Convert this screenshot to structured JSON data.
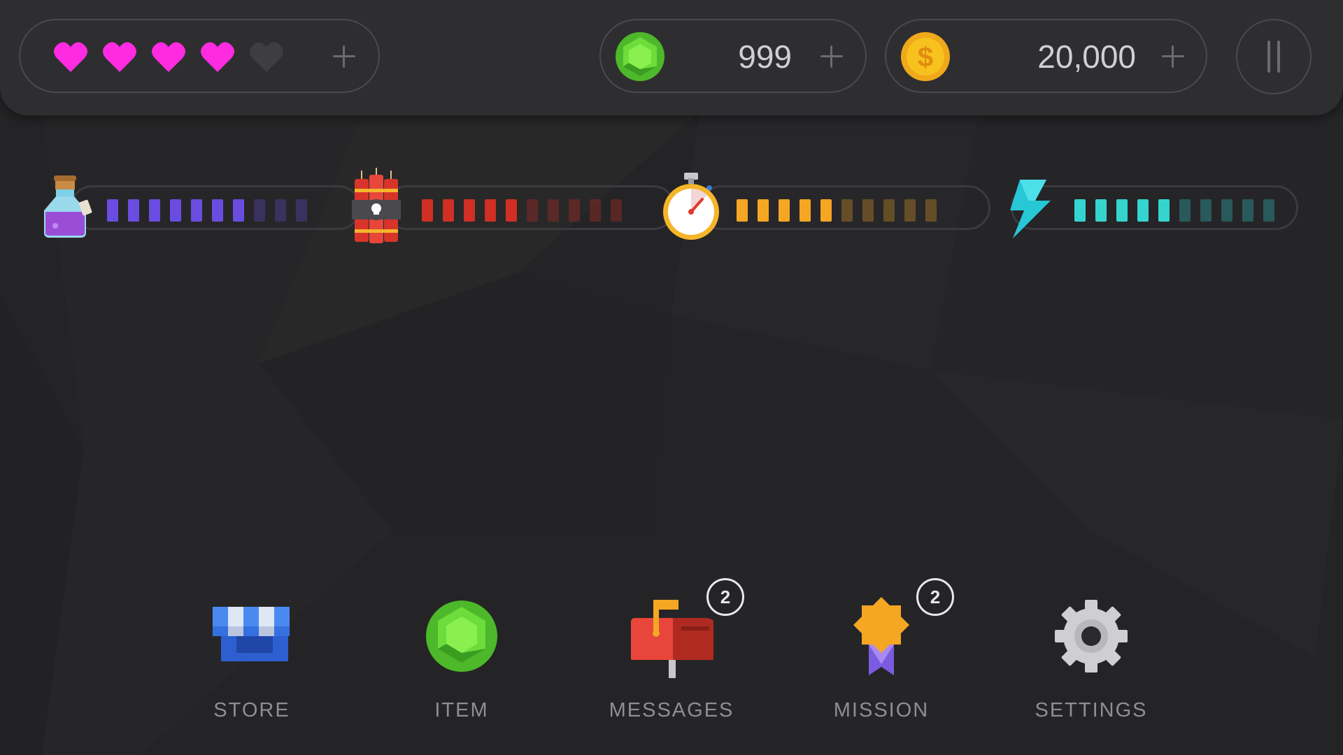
{
  "colors": {
    "heart_full": "#ff2be0",
    "heart_empty": "#3e3e42",
    "gem": "#6ddd3c",
    "coin": "#f7c21d",
    "potion_meter": "#6a4de0",
    "dynamite_meter": "#cf2f24",
    "timer_meter": "#f5a623",
    "energy_meter": "#35d4cf"
  },
  "hearts": {
    "filled": 4,
    "total": 5
  },
  "resources": {
    "gems": {
      "value": "999",
      "icon": "green-gem-icon"
    },
    "coins": {
      "value": "20,000",
      "icon": "gold-coin-icon"
    }
  },
  "meters": [
    {
      "icon": "potion-bottle-icon",
      "level": 7,
      "segments": 10
    },
    {
      "icon": "dynamite-icon",
      "level": 5,
      "segments": 10
    },
    {
      "icon": "stopwatch-icon",
      "level": 5,
      "segments": 10
    },
    {
      "icon": "lightning-bolt-icon",
      "level": 5,
      "segments": 10
    }
  ],
  "nav": [
    {
      "label": "STORE",
      "icon": "store-icon",
      "badge": ""
    },
    {
      "label": "ITEM",
      "icon": "gem-icon",
      "badge": ""
    },
    {
      "label": "MESSAGES",
      "icon": "mailbox-icon",
      "badge": "2"
    },
    {
      "label": "MISSION",
      "icon": "medal-icon",
      "badge": "2"
    },
    {
      "label": "SETTINGS",
      "icon": "gear-icon",
      "badge": ""
    }
  ]
}
